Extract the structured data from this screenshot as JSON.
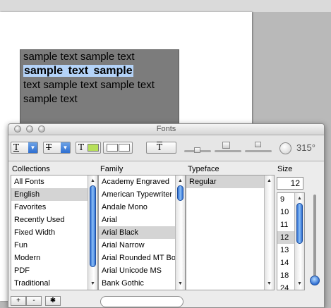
{
  "document": {
    "lines": [
      "sample  text sample  text",
      "sample  text  sample",
      "text sample  text sample  text",
      "sample  text"
    ]
  },
  "panel": {
    "title": "Fonts",
    "toolbar": {
      "underline_glyph": "T",
      "strike_glyph": "T",
      "text_color_glyph": "T",
      "text_color": "#b7e05a",
      "doc_color": "#ffffff",
      "shadow_glyph": "T",
      "angle": "315°"
    },
    "headers": {
      "collections": "Collections",
      "family": "Family",
      "typeface": "Typeface",
      "size": "Size"
    },
    "collections": [
      "All Fonts",
      "English",
      "Favorites",
      "Recently Used",
      "Fixed Width",
      "Fun",
      "Modern",
      "PDF",
      "Traditional"
    ],
    "collections_selected": 1,
    "families": [
      "Academy Engraved",
      "American Typewriter",
      "Andale Mono",
      "Arial",
      "Arial Black",
      "Arial Narrow",
      "Arial Rounded MT Bold",
      "Arial Unicode MS",
      "Bank Gothic"
    ],
    "families_selected": 4,
    "typefaces": [
      "Regular"
    ],
    "typefaces_selected": 0,
    "size_value": "12",
    "sizes": [
      "9",
      "10",
      "11",
      "12",
      "13",
      "14",
      "18",
      "24"
    ],
    "sizes_selected": 3,
    "bottom": {
      "add_label": "+",
      "remove_label": "-",
      "action_label": "✱"
    }
  }
}
